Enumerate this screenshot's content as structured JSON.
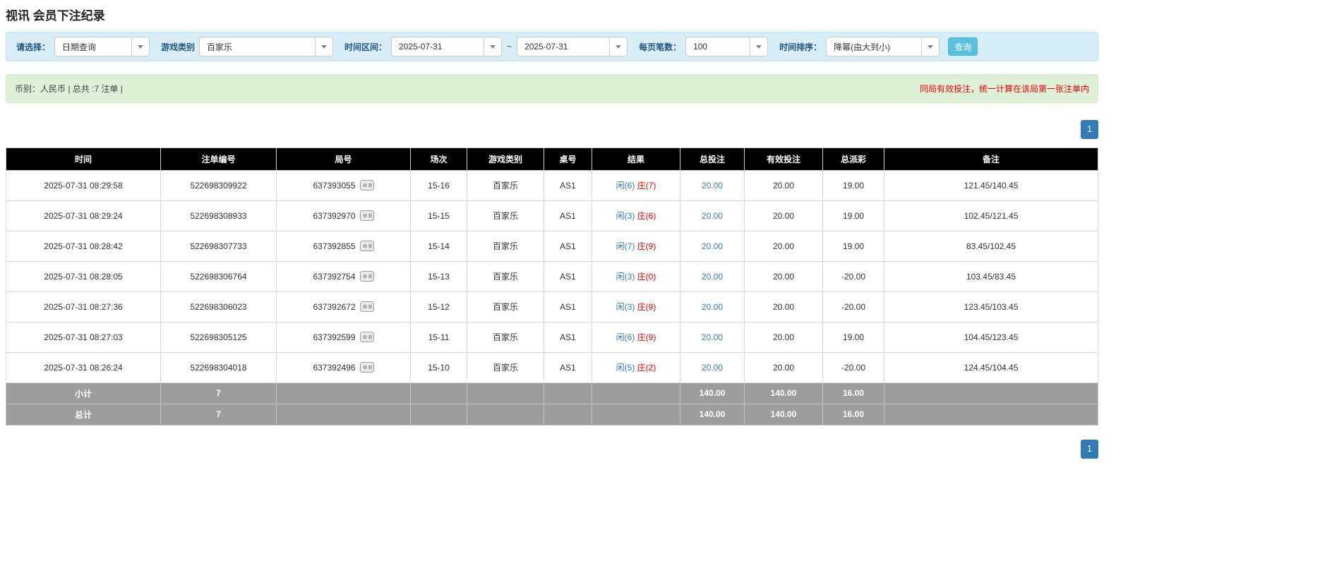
{
  "page": {
    "title": "视讯 会员下注纪录"
  },
  "filter": {
    "labels": {
      "select": "请选择：",
      "game_type": "游戏类别",
      "time_range": "时间区间：",
      "tilde": "~",
      "per_page": "每页笔数：",
      "time_sort": "时间排序："
    },
    "values": {
      "select": "日期查询",
      "game_type": "百家乐",
      "date_from": "2025-07-31",
      "date_to": "2025-07-31",
      "per_page": "100",
      "time_sort": "降幂(由大到小)"
    },
    "search_button": "查询"
  },
  "info": {
    "left": "币别：人民币 | 总共 :7 注单 |",
    "right": "同局有效投注，统一计算在该局第一张注单内"
  },
  "pagination": {
    "page": "1"
  },
  "table": {
    "headers": [
      "时间",
      "注单编号",
      "局号",
      "场次",
      "游戏类别",
      "桌号",
      "结果",
      "总投注",
      "有效投注",
      "总派彩",
      "备注"
    ],
    "rows": [
      {
        "time": "2025-07-31 08:29:58",
        "bet_id": "522698309922",
        "round_id": "637393055",
        "session": "15-16",
        "game": "百家乐",
        "table_no": "AS1",
        "result_player": "闲(6)",
        "result_banker": "庄(7)",
        "total_bet": "20.00",
        "valid_bet": "20.00",
        "payout": "19.00",
        "note": "121.45/140.45"
      },
      {
        "time": "2025-07-31 08:29:24",
        "bet_id": "522698308933",
        "round_id": "637392970",
        "session": "15-15",
        "game": "百家乐",
        "table_no": "AS1",
        "result_player": "闲(3)",
        "result_banker": "庄(6)",
        "total_bet": "20.00",
        "valid_bet": "20.00",
        "payout": "19.00",
        "note": "102.45/121.45"
      },
      {
        "time": "2025-07-31 08:28:42",
        "bet_id": "522698307733",
        "round_id": "637392855",
        "session": "15-14",
        "game": "百家乐",
        "table_no": "AS1",
        "result_player": "闲(7)",
        "result_banker": "庄(9)",
        "total_bet": "20.00",
        "valid_bet": "20.00",
        "payout": "19.00",
        "note": "83.45/102.45"
      },
      {
        "time": "2025-07-31 08:28:05",
        "bet_id": "522698306764",
        "round_id": "637392754",
        "session": "15-13",
        "game": "百家乐",
        "table_no": "AS1",
        "result_player": "闲(3)",
        "result_banker": "庄(0)",
        "total_bet": "20.00",
        "valid_bet": "20.00",
        "payout": "-20.00",
        "note": "103.45/83.45"
      },
      {
        "time": "2025-07-31 08:27:36",
        "bet_id": "522698306023",
        "round_id": "637392672",
        "session": "15-12",
        "game": "百家乐",
        "table_no": "AS1",
        "result_player": "闲(3)",
        "result_banker": "庄(9)",
        "total_bet": "20.00",
        "valid_bet": "20.00",
        "payout": "-20.00",
        "note": "123.45/103.45"
      },
      {
        "time": "2025-07-31 08:27:03",
        "bet_id": "522698305125",
        "round_id": "637392599",
        "session": "15-11",
        "game": "百家乐",
        "table_no": "AS1",
        "result_player": "闲(6)",
        "result_banker": "庄(9)",
        "total_bet": "20.00",
        "valid_bet": "20.00",
        "payout": "19.00",
        "note": "104.45/123.45"
      },
      {
        "time": "2025-07-31 08:26:24",
        "bet_id": "522698304018",
        "round_id": "637392496",
        "session": "15-10",
        "game": "百家乐",
        "table_no": "AS1",
        "result_player": "闲(5)",
        "result_banker": "庄(2)",
        "total_bet": "20.00",
        "valid_bet": "20.00",
        "payout": "-20.00",
        "note": "124.45/104.45"
      }
    ],
    "subtotal": {
      "label": "小计",
      "count": "7",
      "total_bet": "140.00",
      "valid_bet": "140.00",
      "payout": "16.00"
    },
    "total": {
      "label": "总计",
      "count": "7",
      "total_bet": "140.00",
      "valid_bet": "140.00",
      "payout": "16.00"
    }
  },
  "colors": {
    "accent_blue": "#337ab7",
    "player_blue": "#337ab7",
    "banker_red": "#e60000",
    "negative_red": "#e60000",
    "game_green": "#3c763d",
    "header_bg": "#000000",
    "summary_bg": "#9d9d9d",
    "filter_bg": "#d9edf7",
    "info_bg": "#dff0d8",
    "search_button_bg": "#5bc0de"
  }
}
